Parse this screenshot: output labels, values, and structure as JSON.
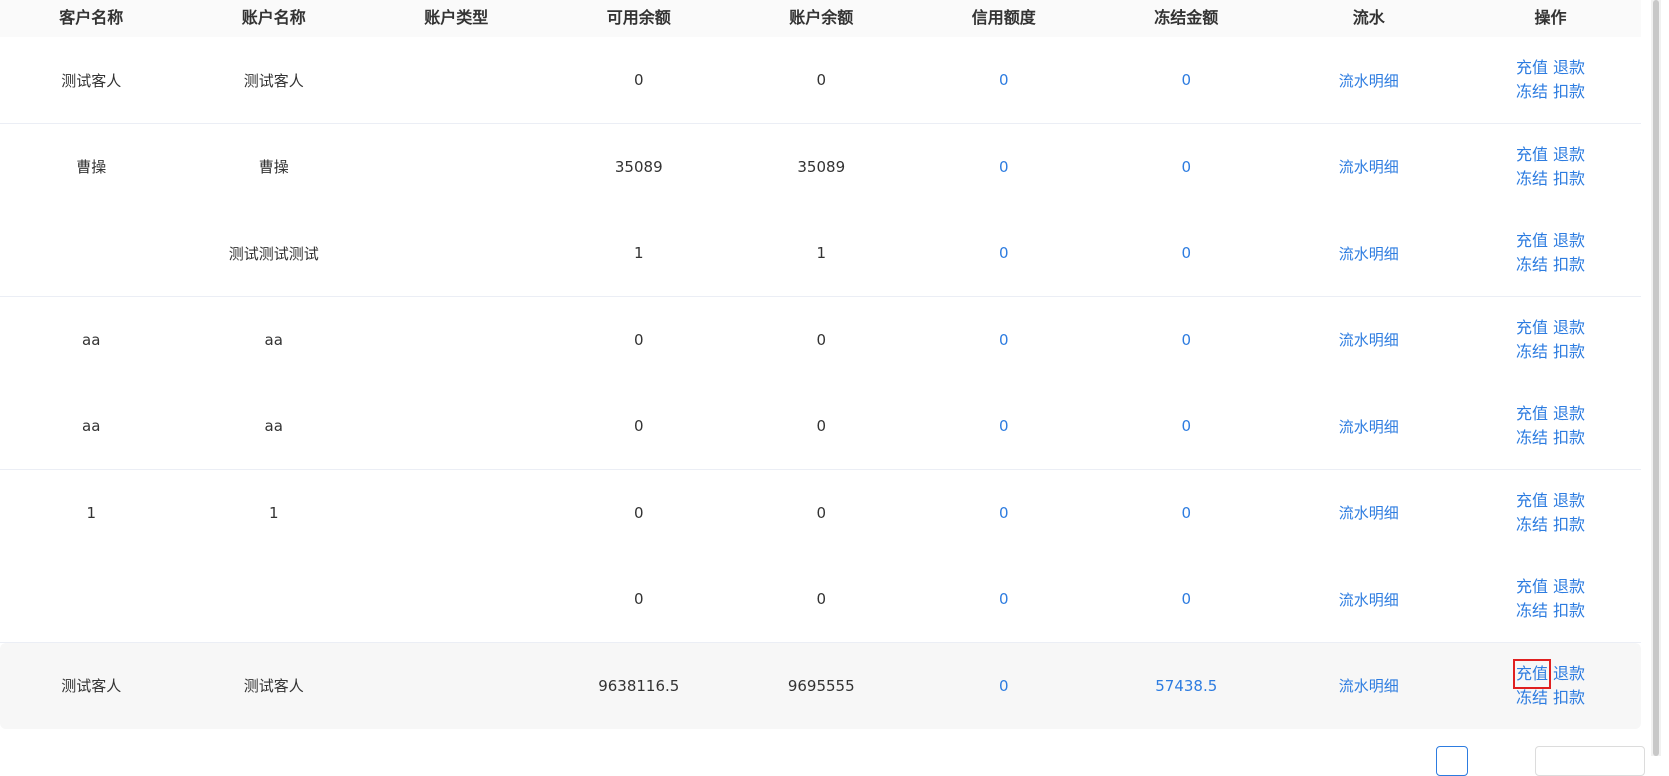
{
  "table": {
    "headers": [
      "客户名称",
      "账户名称",
      "账户类型",
      "可用余额",
      "账户余额",
      "信用额度",
      "冻结金额",
      "流水",
      "操作"
    ],
    "rows": [
      {
        "customer": "测试客人",
        "account": "测试客人",
        "type": "",
        "available": "0",
        "balance": "0",
        "credit": "0",
        "frozen": "0",
        "flow": "流水明细"
      },
      {
        "customer": "曹操",
        "account": "曹操",
        "type": "",
        "available": "35089",
        "balance": "35089",
        "credit": "0",
        "frozen": "0",
        "flow": "流水明细"
      },
      {
        "customer": "",
        "account": "测试测试测试",
        "type": "",
        "available": "1",
        "balance": "1",
        "credit": "0",
        "frozen": "0",
        "flow": "流水明细"
      },
      {
        "customer": "aa",
        "account": "aa",
        "type": "",
        "available": "0",
        "balance": "0",
        "credit": "0",
        "frozen": "0",
        "flow": "流水明细"
      },
      {
        "customer": "aa",
        "account": "aa",
        "type": "",
        "available": "0",
        "balance": "0",
        "credit": "0",
        "frozen": "0",
        "flow": "流水明细"
      },
      {
        "customer": "1",
        "account": "1",
        "type": "",
        "available": "0",
        "balance": "0",
        "credit": "0",
        "frozen": "0",
        "flow": "流水明细"
      },
      {
        "customer": "",
        "account": "",
        "type": "",
        "available": "0",
        "balance": "0",
        "credit": "0",
        "frozen": "0",
        "flow": "流水明细"
      },
      {
        "customer": "测试客人",
        "account": "测试客人",
        "type": "",
        "available": "9638116.5",
        "balance": "9695555",
        "credit": "0",
        "frozen": "57438.5",
        "flow": "流水明细"
      }
    ],
    "ops": {
      "recharge": "充值",
      "refund": "退款",
      "freeze": "冻结",
      "deduct": "扣款"
    },
    "highlighted_row": 7
  },
  "colors": {
    "link": "#2d7ce0",
    "highlight_box": "#e02020",
    "hover_row": "#f7f7f7"
  }
}
